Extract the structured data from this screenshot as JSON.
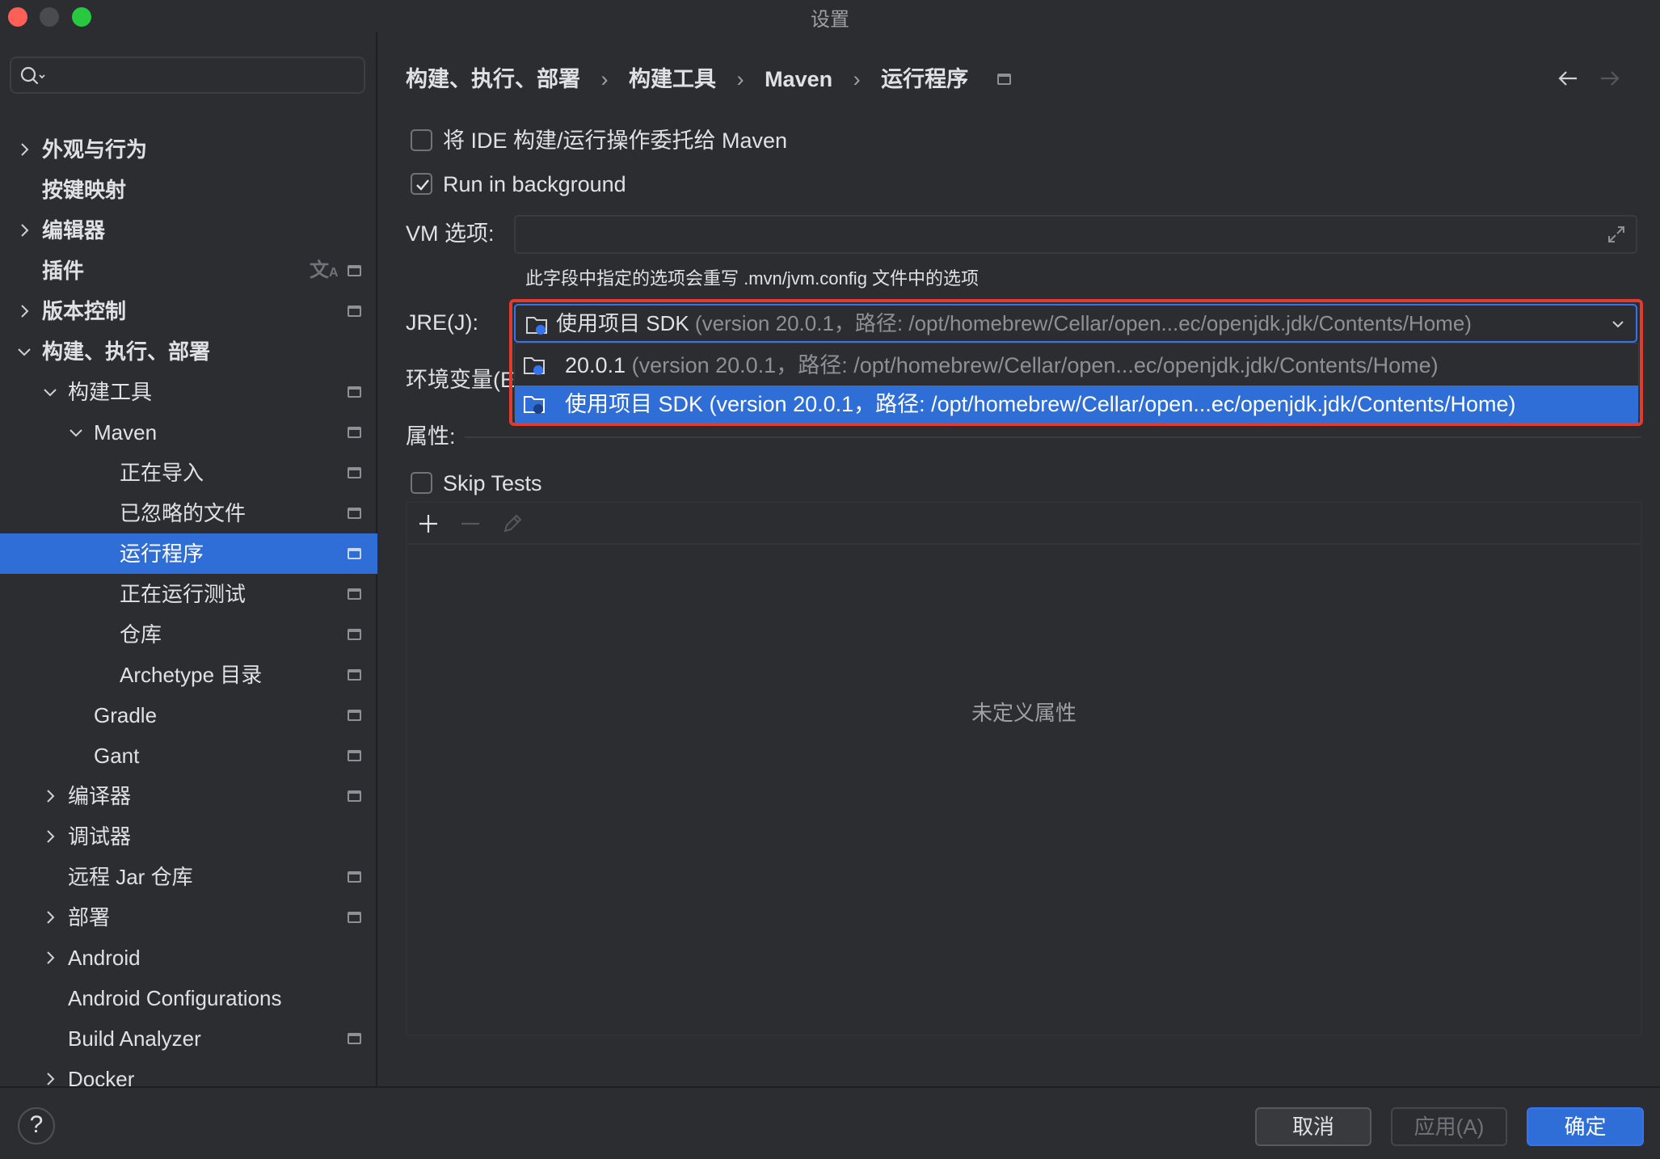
{
  "window": {
    "title": "设置"
  },
  "search": {
    "placeholder": ""
  },
  "sidebar": {
    "items": [
      {
        "label": "外观与行为"
      },
      {
        "label": "按键映射"
      },
      {
        "label": "编辑器"
      },
      {
        "label": "插件"
      },
      {
        "label": "版本控制"
      },
      {
        "label": "构建、执行、部署"
      },
      {
        "label": "构建工具"
      },
      {
        "label": "Maven"
      },
      {
        "label": "正在导入"
      },
      {
        "label": "已忽略的文件"
      },
      {
        "label": "运行程序"
      },
      {
        "label": "正在运行测试"
      },
      {
        "label": "仓库"
      },
      {
        "label": "Archetype 目录"
      },
      {
        "label": "Gradle"
      },
      {
        "label": "Gant"
      },
      {
        "label": "编译器"
      },
      {
        "label": "调试器"
      },
      {
        "label": "远程 Jar 仓库"
      },
      {
        "label": "部署"
      },
      {
        "label": "Android"
      },
      {
        "label": "Android Configurations"
      },
      {
        "label": "Build Analyzer"
      },
      {
        "label": "Docker"
      }
    ]
  },
  "breadcrumb": {
    "items": [
      "构建、执行、部署",
      "构建工具",
      "Maven",
      "运行程序"
    ],
    "separator": "›"
  },
  "form": {
    "delegate_label": "将 IDE 构建/运行操作委托给 Maven",
    "delegate_checked": false,
    "background_label": "Run in background",
    "background_checked": true,
    "vm_label": "VM 选项:",
    "vm_value": "",
    "vm_hint": "此字段中指定的选项会重写 .mvn/jvm.config 文件中的选项",
    "jre_label": "JRE(J):",
    "jre_selected_main": "使用项目 SDK",
    "jre_selected_detail": "(version 20.0.1，路径: /opt/homebrew/Cellar/open...ec/openjdk.jdk/Contents/Home)",
    "env_label": "环境变量(E",
    "props_label": "属性:",
    "skip_tests_label": "Skip Tests",
    "skip_tests_checked": false
  },
  "dropdown": {
    "options": [
      {
        "main": "20.0.1",
        "detail": "(version 20.0.1，路径: /opt/homebrew/Cellar/open...ec/openjdk.jdk/Contents/Home)",
        "selected": false
      },
      {
        "main": "使用项目 SDK",
        "detail": "(version 20.0.1，路径: /opt/homebrew/Cellar/open...ec/openjdk.jdk/Contents/Home)",
        "selected": true
      }
    ]
  },
  "properties": {
    "empty_text": "未定义属性"
  },
  "footer": {
    "help": "?",
    "cancel": "取消",
    "apply": "应用(A)",
    "ok": "确定"
  },
  "colors": {
    "accent": "#2e6ed6",
    "highlight_border": "#e23b2e",
    "background": "#2b2d30"
  }
}
